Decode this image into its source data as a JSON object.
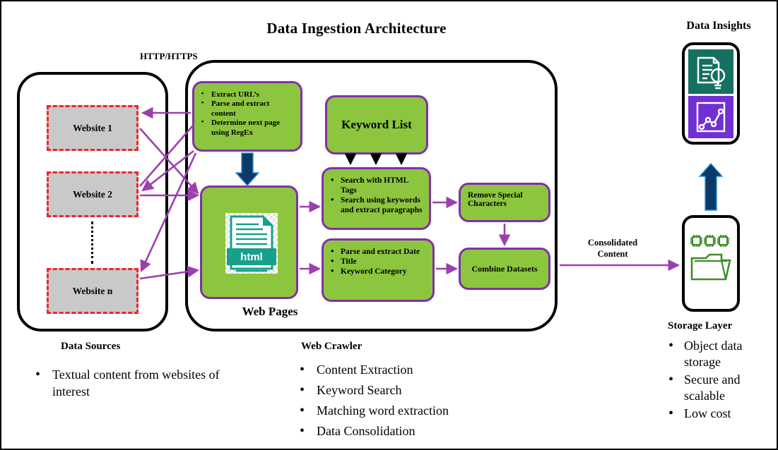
{
  "diagram": {
    "title": "Data Ingestion Architecture",
    "insights_title": "Data Insights",
    "protocol_label": "HTTP/HTTPS",
    "consolidated_label_line1": "Consolidated",
    "consolidated_label_line2": "Content"
  },
  "colors": {
    "green_fill": "#8cc63e",
    "purple_border": "#8031a7",
    "purple_arrow": "#9c3fae",
    "navy_arrow": "#0b3a68",
    "red_dashed": "#ef2626",
    "gray_fill": "#c9c9c9",
    "teal_icon": "#147060",
    "violet_icon": "#7130d4",
    "folder_green": "#3e8c28",
    "black": "#000000"
  },
  "data_sources": {
    "caption": "Data Sources",
    "websites": [
      {
        "label": "Website 1"
      },
      {
        "label": "Website 2"
      },
      {
        "label": "Website n"
      }
    ],
    "bullets": [
      "Textual content from websites of interest"
    ]
  },
  "web_crawler": {
    "caption": "Web Crawler",
    "bullets": [
      "Content Extraction",
      "Keyword Search",
      "Matching word extraction",
      "Data Consolidation"
    ],
    "boxes": {
      "extract": {
        "items": [
          "Extract URL’s",
          "Parse and extract content",
          "Determine next page using RegEx"
        ]
      },
      "keyword_list": {
        "label": "Keyword List"
      },
      "search": {
        "items": [
          "Search with HTML Tags",
          "Search using keywords and extract paragraphs"
        ]
      },
      "parse": {
        "items": [
          "Parse and extract Date",
          "Title",
          "Keyword Category"
        ]
      },
      "remove_special": {
        "label": "Remove Special Characters"
      },
      "combine": {
        "label": "Combine Datasets"
      },
      "web_pages": {
        "caption": "Web Pages",
        "icon_label": "html"
      }
    }
  },
  "storage_layer": {
    "caption": "Storage Layer",
    "bullets": [
      "Object data storage",
      "Secure and scalable",
      "Low cost"
    ]
  },
  "icons": {
    "html_document": "html-file-icon",
    "document_idea": "document-lightbulb-icon",
    "line_chart": "line-chart-icon",
    "storage_folder": "folder-gears-icon"
  }
}
